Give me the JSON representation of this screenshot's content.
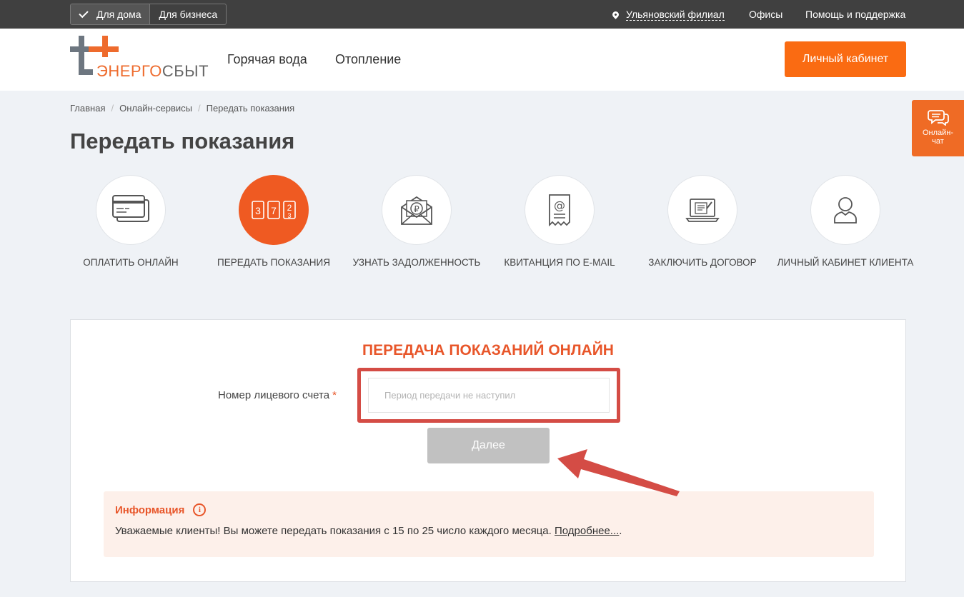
{
  "topbar": {
    "for_home": "Для дома",
    "for_business": "Для бизнеса",
    "branch": "Ульяновский филиал",
    "offices": "Офисы",
    "help": "Помощь и поддержка"
  },
  "header": {
    "logo_part1": "ЭНЕРГО",
    "logo_part2": "СБЫТ",
    "nav": [
      "Горячая вода",
      "Отопление"
    ],
    "cabinet_button": "Личный кабинет"
  },
  "chat": {
    "label_line1": "Онлайн-",
    "label_line2": "чат"
  },
  "breadcrumb": [
    "Главная",
    "Онлайн-сервисы",
    "Передать показания"
  ],
  "page_title": "Передать показания",
  "services": [
    {
      "label": "Оплатить онлайн",
      "icon": "credit-card-icon"
    },
    {
      "label": "Передать показания",
      "icon": "meter-digits-icon"
    },
    {
      "label": "Узнать задолженность",
      "icon": "envelope-ruble-icon"
    },
    {
      "label": "Квитанция по e-mail",
      "icon": "email-receipt-icon"
    },
    {
      "label": "Заключить договор",
      "icon": "laptop-contract-icon"
    },
    {
      "label": "Личный кабинет клиента",
      "icon": "user-icon"
    }
  ],
  "form": {
    "title": "ПЕРЕДАЧА ПОКАЗАНИЙ ОНЛАЙН",
    "account_label": "Номер лицевого счета",
    "required_mark": "*",
    "account_placeholder": "Период передачи не наступил",
    "next_button": "Далее"
  },
  "info": {
    "title": "Информация",
    "icon_glyph": "i",
    "text": "Уважаемые клиенты! Вы можете передать показания с 15 по 25 число каждого месяца. ",
    "more_link": "Подробнее...",
    "more_suffix": "."
  },
  "colors": {
    "accent": "#fa6b12",
    "title_orange": "#e8562a",
    "highlight_red": "#d44c45",
    "topbar": "#404040",
    "disabled_button": "#c1c1c1"
  }
}
